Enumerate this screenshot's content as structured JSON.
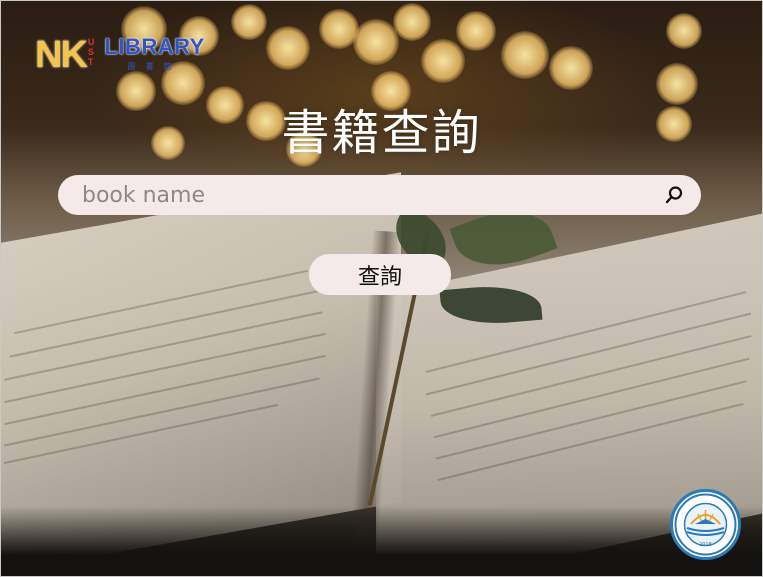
{
  "logo": {
    "nk": "NK",
    "ust": [
      "U",
      "S",
      "T"
    ],
    "library": "LIBRARY",
    "library_sub": "圖書館"
  },
  "title": "書籍查詢",
  "search": {
    "placeholder": "book name",
    "value": "",
    "icon": "search-icon"
  },
  "submit_label": "查詢",
  "seal": {
    "year": "2018"
  },
  "colors": {
    "panel": "#f5eaea",
    "logo_gold": "#f4c34a",
    "logo_blue": "#2f55c9",
    "logo_red": "#e03030",
    "seal_blue": "#2a7ab8"
  }
}
